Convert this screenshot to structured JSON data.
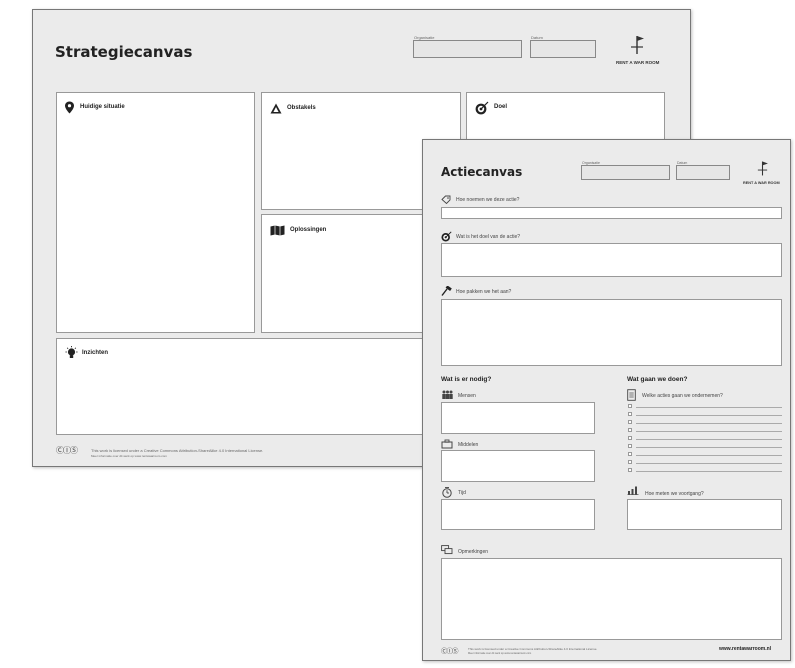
{
  "strategy": {
    "title": "Strategiecanvas",
    "org_label": "Organisatie",
    "date_label": "Datum",
    "logo_text": "RENT A WAR ROOM",
    "boxes": {
      "situation": {
        "label": "Huidige situatie",
        "icon": "location-pin-icon"
      },
      "obstacles": {
        "label": "Obstakels",
        "icon": "warning-triangle-icon"
      },
      "goal": {
        "label": "Doel",
        "icon": "target-icon"
      },
      "solutions": {
        "label": "Oplossingen",
        "icon": "map-icon"
      },
      "insights": {
        "label": "Inzichten",
        "icon": "lightbulb-icon"
      }
    },
    "license": "This work is licensed under a Creative Commons Attribution-ShareAlike 4.0 International License.",
    "license_sub": "Meer informatie over dit werk op www.rentawarroom.com",
    "cc_glyphs": "ⒸⒾⓈ"
  },
  "actie": {
    "title": "Actiecanvas",
    "org_label": "Organisatie",
    "date_label": "Datum",
    "logo_text": "RENT A WAR ROOM",
    "q_name": "Hoe noemen we deze actie?",
    "q_goal": "Wat is het doel van de actie?",
    "q_how": "Hoe pakken we het aan?",
    "needed_title": "Wat is er nodig?",
    "todo_title": "Wat gaan we doen?",
    "people": "Mensen",
    "means": "Middelen",
    "time": "Tijd",
    "actions_q": "Welke acties gaan we ondernemen?",
    "progress_q": "Hoe meten we voortgang?",
    "remarks": "Opmerkingen",
    "license": "This work is licensed under a Creative Commons Attribution-ShareAlike 4.0 International License.",
    "license_sub": "Meer informatie over dit werk op www.rentawarroom.com",
    "website": "www.rentawarroom.nl",
    "cc_glyphs": "ⒸⒾⓈ"
  }
}
